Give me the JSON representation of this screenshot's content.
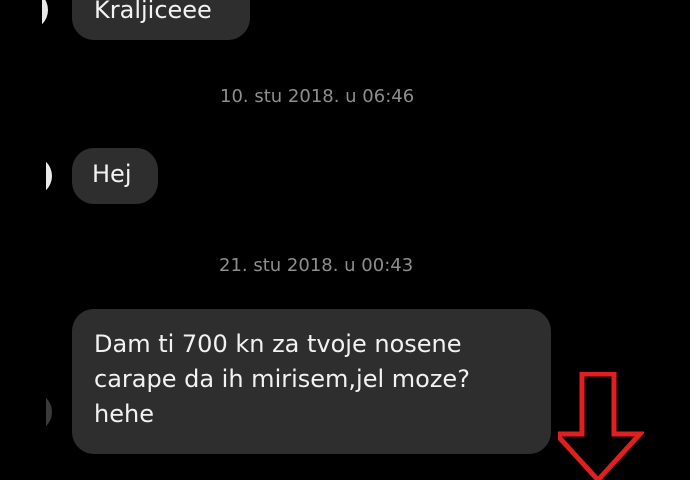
{
  "conversation": {
    "messages": [
      {
        "text": "Kraljiceee"
      },
      {
        "text": "Hej"
      },
      {
        "lines": [
          "Dam ti 700 kn za tvoje nosene",
          "carape da ih mirisem,jel moze?",
          "hehe"
        ]
      }
    ],
    "timestamps": [
      "10. stu 2018. u 06:46",
      "21. stu 2018. u 00:43"
    ]
  },
  "colors": {
    "background": "#000000",
    "bubble": "#2e2e2e",
    "bubble_text": "#f2f2f2",
    "timestamp_text": "#8e8e8e",
    "annotation_arrow": "#e02020"
  },
  "annotation": {
    "icon": "red-down-arrow-icon"
  }
}
